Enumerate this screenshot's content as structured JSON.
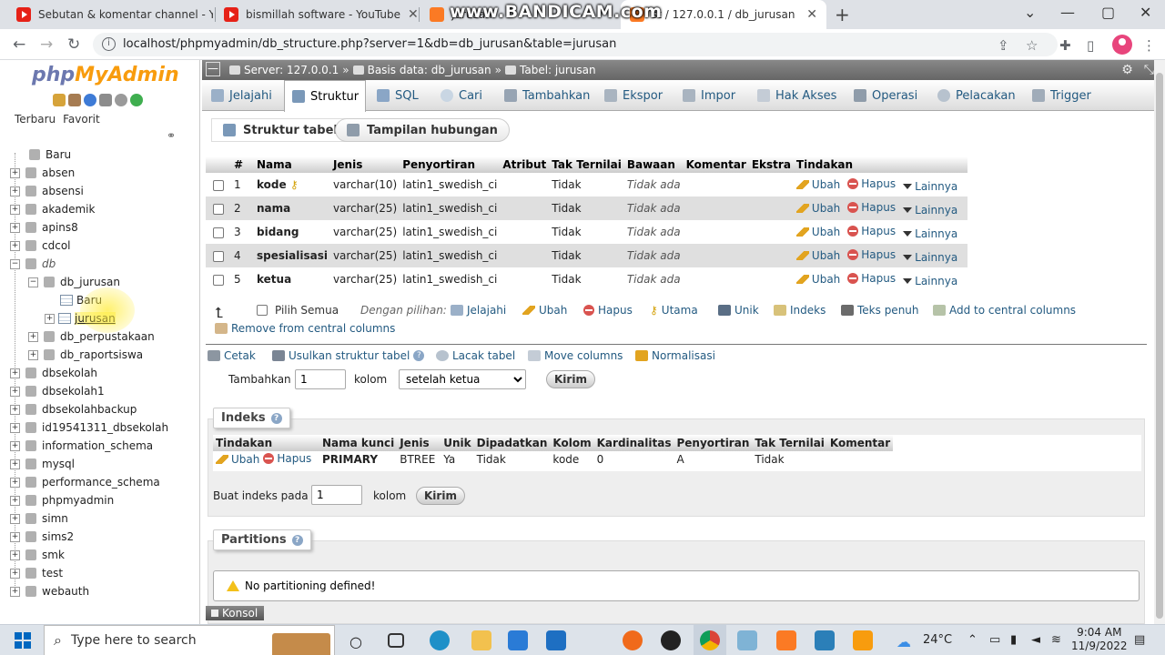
{
  "browser": {
    "tabs": [
      {
        "title": "Sebutan & komentar channel - Yo",
        "icon": "youtube-icon"
      },
      {
        "title": "bismillah software - YouTube",
        "icon": "youtube-icon"
      },
      {
        "title": "jurusan",
        "icon": "xampp-icon"
      },
      {
        "title": "st / 127.0.0.1 / db_jurusan",
        "icon": "xampp-icon"
      }
    ],
    "watermark": "www.BANDICAM.com",
    "url": "localhost/phpmyadmin/db_structure.php?server=1&db=db_jurusan&table=jurusan"
  },
  "nav": {
    "logo_php": "php",
    "logo_myadmin": "MyAdmin",
    "tab_recent": "Terbaru",
    "tab_favorites": "Favorit",
    "new_label": "Baru",
    "databases_top": [
      "absen",
      "absensi",
      "akademik",
      "apins8",
      "cdcol"
    ],
    "group_db": "db",
    "db_jurusan": "db_jurusan",
    "db_jurusan_new": "Baru",
    "db_jurusan_table": "jurusan",
    "db_perpustakaan": "db_perpustakaan",
    "db_raportsiswa": "db_raportsiswa",
    "databases_bottom": [
      "dbsekolah",
      "dbsekolah1",
      "dbsekolahbackup",
      "id19541311_dbsekolah",
      "information_schema",
      "mysql",
      "performance_schema",
      "phpmyadmin",
      "simn",
      "sims2",
      "smk",
      "test",
      "webauth"
    ]
  },
  "breadcrumb": {
    "server": "Server: 127.0.0.1",
    "database": "Basis data: db_jurusan",
    "table": "Tabel: jurusan"
  },
  "menu": [
    "Jelajahi",
    "Struktur",
    "SQL",
    "Cari",
    "Tambahkan",
    "Ekspor",
    "Impor",
    "Hak Akses",
    "Operasi",
    "Pelacakan",
    "Trigger"
  ],
  "subtabs": {
    "structure": "Struktur tabel",
    "relation": "Tampilan hubungan"
  },
  "structure": {
    "headers": [
      "#",
      "Nama",
      "Jenis",
      "Penyortiran",
      "Atribut",
      "Tak Ternilai",
      "Bawaan",
      "Komentar",
      "Ekstra",
      "Tindakan"
    ],
    "rows": [
      {
        "no": "1",
        "name": "kode",
        "type": "varchar(10)",
        "collation": "latin1_swedish_ci",
        "null": "Tidak",
        "default": "Tidak ada",
        "primary": true
      },
      {
        "no": "2",
        "name": "nama",
        "type": "varchar(25)",
        "collation": "latin1_swedish_ci",
        "null": "Tidak",
        "default": "Tidak ada",
        "primary": false
      },
      {
        "no": "3",
        "name": "bidang",
        "type": "varchar(25)",
        "collation": "latin1_swedish_ci",
        "null": "Tidak",
        "default": "Tidak ada",
        "primary": false
      },
      {
        "no": "4",
        "name": "spesialisasi",
        "type": "varchar(25)",
        "collation": "latin1_swedish_ci",
        "null": "Tidak",
        "default": "Tidak ada",
        "primary": false
      },
      {
        "no": "5",
        "name": "ketua",
        "type": "varchar(25)",
        "collation": "latin1_swedish_ci",
        "null": "Tidak",
        "default": "Tidak ada",
        "primary": false
      }
    ],
    "actions": {
      "edit": "Ubah",
      "drop": "Hapus",
      "more": "Lainnya"
    }
  },
  "with_selected": {
    "check_all": "Pilih Semua",
    "label": "Dengan pilihan:",
    "browse": "Jelajahi",
    "edit": "Ubah",
    "drop": "Hapus",
    "primary": "Utama",
    "unique": "Unik",
    "index": "Indeks",
    "fulltext": "Teks penuh",
    "add_central": "Add to central columns",
    "remove_central": "Remove from central columns"
  },
  "tools": {
    "print": "Cetak",
    "propose": "Usulkan struktur tabel",
    "track": "Lacak tabel",
    "move": "Move columns",
    "normalize": "Normalisasi"
  },
  "add_columns": {
    "label": "Tambahkan",
    "count": "1",
    "unit": "kolom",
    "position": "setelah ketua",
    "submit": "Kirim"
  },
  "indexes": {
    "legend": "Indeks",
    "headers": [
      "Tindakan",
      "Nama kunci",
      "Jenis",
      "Unik",
      "Dipadatkan",
      "Kolom",
      "Kardinalitas",
      "Penyortiran",
      "Tak Ternilai",
      "Komentar"
    ],
    "row": {
      "edit": "Ubah",
      "drop": "Hapus",
      "key_name": "PRIMARY",
      "type": "BTREE",
      "unique": "Ya",
      "packed": "Tidak",
      "column": "kode",
      "cardinality": "0",
      "collation": "A",
      "null": "Tidak",
      "comment": ""
    },
    "create_label": "Buat indeks pada",
    "create_count": "1",
    "create_unit": "kolom",
    "create_submit": "Kirim"
  },
  "partitions": {
    "legend": "Partitions",
    "notice": "No partitioning defined!"
  },
  "console": "Konsol",
  "taskbar": {
    "search_placeholder": "Type here to search",
    "weather": "24°C",
    "time": "9:04 AM",
    "date": "11/9/2022"
  }
}
